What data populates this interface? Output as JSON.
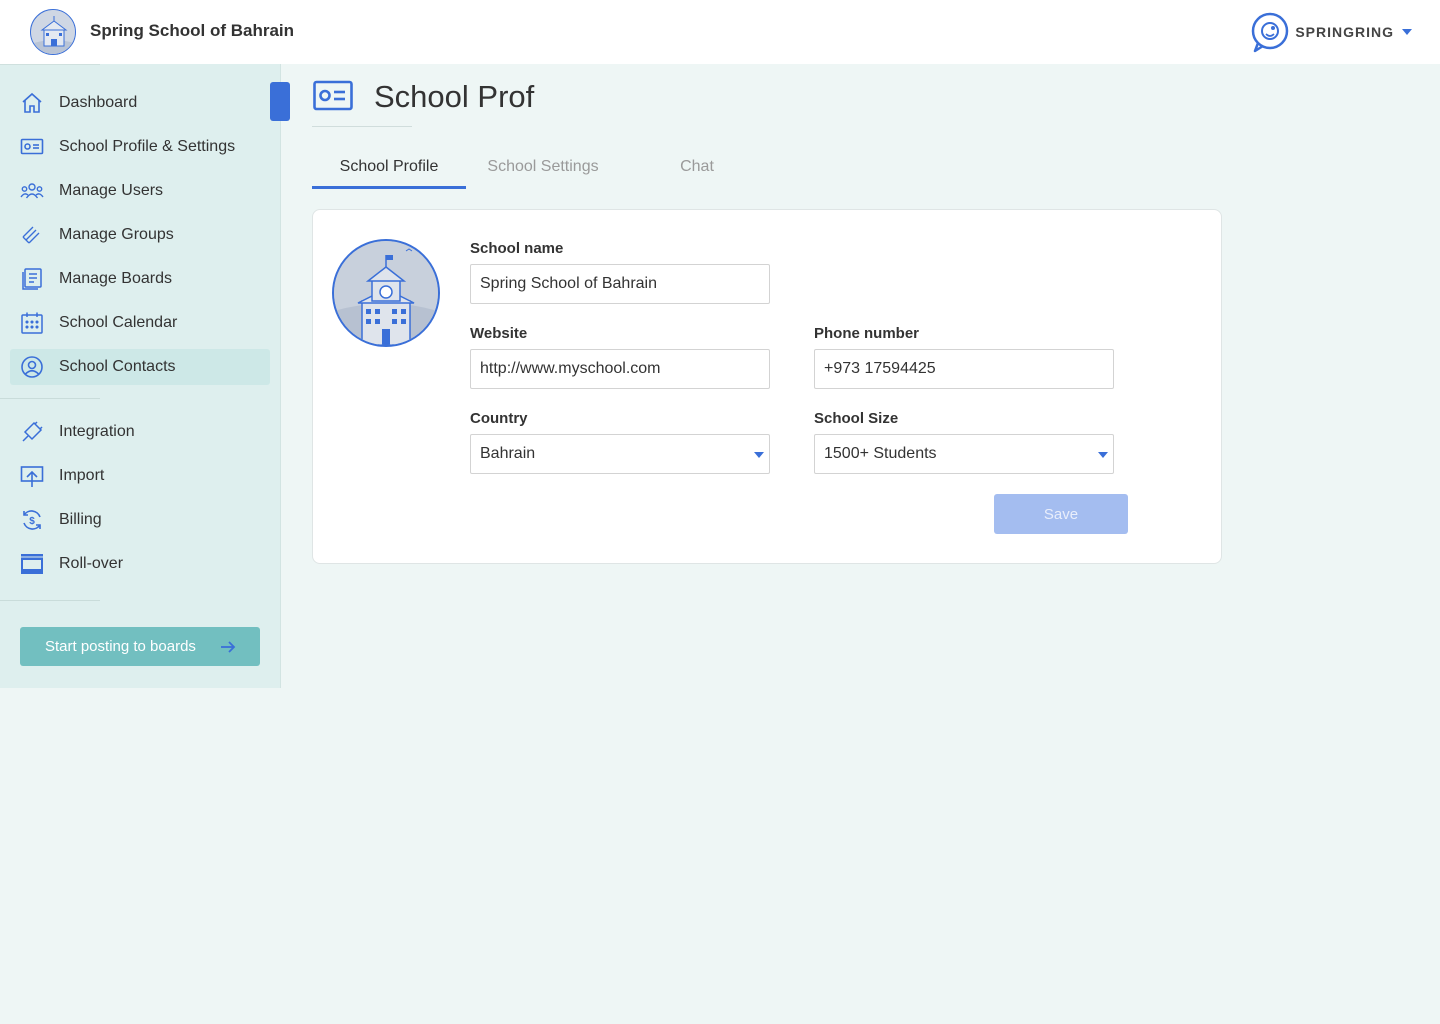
{
  "header": {
    "school_name": "Spring School of Bahrain",
    "brand_name": "SPRINGRING"
  },
  "sidebar": {
    "items": [
      {
        "label": "Dashboard",
        "icon": "home-icon"
      },
      {
        "label": "School Profile & Settings",
        "icon": "id-card-icon"
      },
      {
        "label": "Manage Users",
        "icon": "users-icon"
      },
      {
        "label": "Manage Groups",
        "icon": "groups-icon"
      },
      {
        "label": "Manage Boards",
        "icon": "boards-icon"
      },
      {
        "label": "School Calendar",
        "icon": "calendar-icon"
      },
      {
        "label": "School Contacts",
        "icon": "contact-icon"
      },
      {
        "label": "Integration",
        "icon": "plug-icon"
      },
      {
        "label": "Import",
        "icon": "import-icon"
      },
      {
        "label": "Billing",
        "icon": "billing-icon"
      },
      {
        "label": "Roll-over",
        "icon": "rollover-icon"
      }
    ],
    "active_item": "School Contacts",
    "cta_label": "Start posting to boards"
  },
  "main": {
    "title": "School Prof",
    "tabs": [
      {
        "label": "School Profile",
        "active": true
      },
      {
        "label": "School Settings",
        "active": false
      },
      {
        "label": "Chat",
        "active": false
      }
    ],
    "form": {
      "school_name_label": "School name",
      "school_name_value": "Spring School of Bahrain",
      "website_label": "Website",
      "website_value": "http://www.myschool.com",
      "phone_label": "Phone number",
      "phone_value": "+973 17594425",
      "country_label": "Country",
      "country_value": "Bahrain",
      "size_label": "School Size",
      "size_value": "1500+ Students",
      "save_label": "Save"
    }
  },
  "colors": {
    "accent": "#3a6fd8",
    "sidebar_bg": "#deefee",
    "page_bg": "#eef6f5",
    "cta_bg": "#72bfc0",
    "save_disabled": "#a4bdf0"
  }
}
